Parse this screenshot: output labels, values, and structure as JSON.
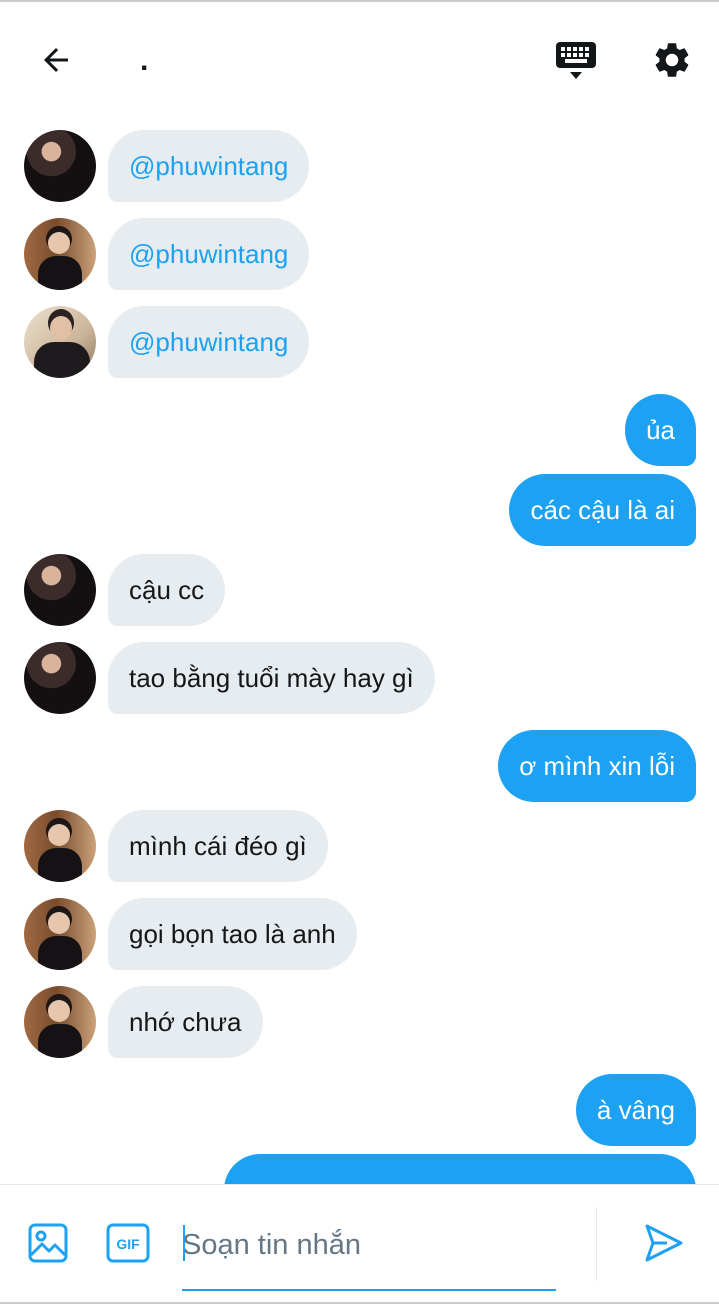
{
  "header": {
    "title": ".",
    "icons": {
      "back": "arrow-left-icon",
      "keyboard": "keyboard-icon",
      "settings": "gear-icon"
    }
  },
  "messages": [
    {
      "side": "in",
      "avatar": "a1",
      "text": "@phuwintang",
      "mention": true
    },
    {
      "side": "in",
      "avatar": "a2",
      "text": "@phuwintang",
      "mention": true
    },
    {
      "side": "in",
      "avatar": "a3",
      "text": "@phuwintang",
      "mention": true
    },
    {
      "side": "out",
      "text": "ủa"
    },
    {
      "side": "out",
      "text": "các cậu là ai"
    },
    {
      "side": "in",
      "avatar": "a1",
      "text": "cậu cc"
    },
    {
      "side": "in",
      "avatar": "a1",
      "text": "tao bằng tuổi mày hay gì"
    },
    {
      "side": "out",
      "text": "ơ mình xin lỗi"
    },
    {
      "side": "in",
      "avatar": "a2",
      "text": "mình cái đéo gì"
    },
    {
      "side": "in",
      "avatar": "a2",
      "text": "gọi bọn tao là anh"
    },
    {
      "side": "in",
      "avatar": "a2",
      "text": "nhớ chưa"
    },
    {
      "side": "out",
      "text": "à vâng"
    },
    {
      "side": "out",
      "text": ""
    }
  ],
  "composer": {
    "placeholder": "Soạn tin nhắn",
    "value": "",
    "icons": {
      "image": "image-icon",
      "gif": "gif-icon",
      "send": "send-icon"
    },
    "gif_label": "GIF"
  },
  "colors": {
    "accent": "#1da1f2",
    "incoming_bubble": "#e6ecf0",
    "text": "#14171a",
    "placeholder": "#657786"
  }
}
